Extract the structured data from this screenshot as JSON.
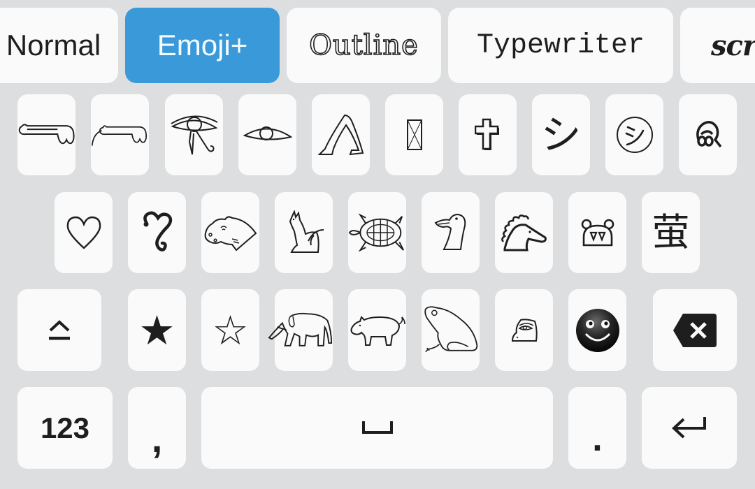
{
  "font_tabs": [
    {
      "label": "Normal",
      "active": false
    },
    {
      "label": "Emoji+",
      "active": true
    },
    {
      "label": "Outline",
      "active": false
    },
    {
      "label": "Typewriter",
      "active": false
    },
    {
      "label": "scr",
      "active": false
    }
  ],
  "colors": {
    "accent": "#3a9ad9",
    "key_bg": "#fafafa",
    "keyboard_bg": "#dcdedf",
    "glyph": "#1e1e1e"
  },
  "row1": [
    {
      "name": "pointing-hand-glyph",
      "icon": "hieroglyph-hand"
    },
    {
      "name": "pointing-hand-arm-glyph",
      "icon": "hieroglyph-hand-arm"
    },
    {
      "name": "eye-of-horus-glyph",
      "icon": "eye-of-horus"
    },
    {
      "name": "eye-glyph",
      "icon": "hieroglyph-eye"
    },
    {
      "name": "legs-glyph",
      "icon": "hieroglyph-legs"
    },
    {
      "name": "crossed-box-glyph",
      "icon": "x-box"
    },
    {
      "name": "latin-cross-glyph",
      "icon": "shadowed-cross",
      "char": "✞"
    },
    {
      "name": "katakana-shi-glyph",
      "icon": "katakana-shi",
      "char": "シ"
    },
    {
      "name": "circled-shi-glyph",
      "icon": "circled-katakana-shi",
      "char": "㋛"
    },
    {
      "name": "malayalam-glyph",
      "icon": "malayalam-letter"
    }
  ],
  "row2": [
    {
      "name": "heart-glyph",
      "icon": "white-heart",
      "char": "♡"
    },
    {
      "name": "snake-glyph",
      "icon": "snake-curl"
    },
    {
      "name": "hippo-glyph",
      "icon": "hippopotamus-head"
    },
    {
      "name": "cat-glyph",
      "icon": "seated-cat"
    },
    {
      "name": "turtle-glyph",
      "icon": "turtle"
    },
    {
      "name": "bird-head-glyph",
      "icon": "bird-head"
    },
    {
      "name": "horse-head-glyph",
      "icon": "horse-head"
    },
    {
      "name": "animal-face-glyph",
      "icon": "animal-face-fangs"
    },
    {
      "name": "cjk-glyph",
      "icon": "cjk-character",
      "char": "萤"
    }
  ],
  "row3": [
    {
      "name": "shift-key",
      "icon": "shift-icon",
      "interactive": true
    },
    {
      "name": "black-star-glyph",
      "icon": "black-star",
      "char": "★"
    },
    {
      "name": "white-star-glyph",
      "icon": "white-star",
      "char": "☆"
    },
    {
      "name": "elephant-glyph",
      "icon": "elephant"
    },
    {
      "name": "pig-glyph",
      "icon": "pig"
    },
    {
      "name": "frog-glyph",
      "icon": "frog"
    },
    {
      "name": "face-profile-glyph",
      "icon": "face-profile"
    },
    {
      "name": "smiley-glyph",
      "icon": "black-smiley"
    },
    {
      "name": "backspace-key",
      "icon": "backspace-icon"
    }
  ],
  "row4": {
    "numbers_label": "123",
    "comma": ",",
    "space_symbol": "␣",
    "period": ".",
    "enter_symbol": "↵"
  }
}
